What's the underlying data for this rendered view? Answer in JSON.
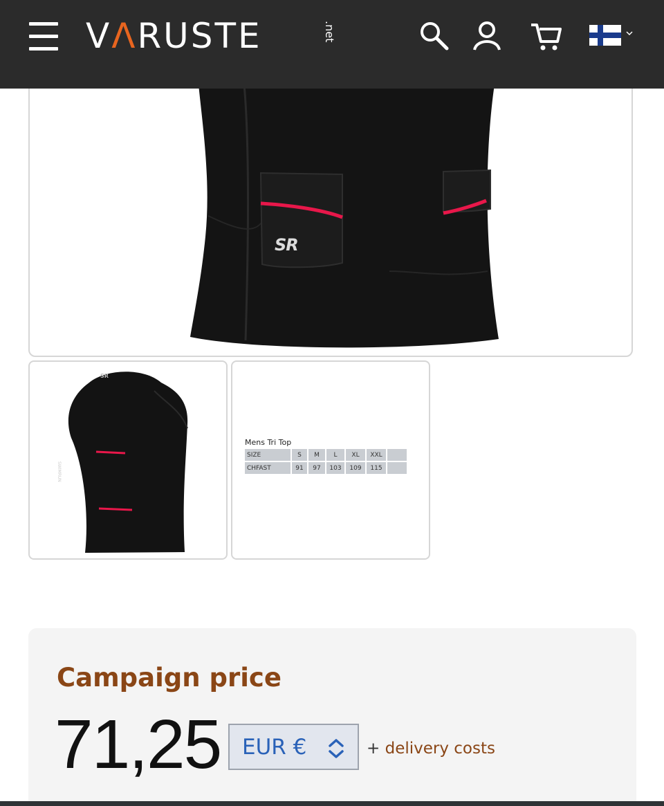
{
  "header": {
    "logo_text_1": "V",
    "logo_text_accent": "Λ",
    "logo_text_2": "RUSTE",
    "logo_suffix": ".net",
    "icons": [
      "menu-icon",
      "search-icon",
      "user-icon",
      "cart-icon",
      "finland-flag-icon"
    ]
  },
  "gallery": {
    "main_badge": "SR",
    "thumb_badge": "SR",
    "thumb_side_text": "SWIMRUN"
  },
  "size_chart": {
    "title": "Mens Tri Top",
    "header": [
      "SIZE",
      "S",
      "M",
      "L",
      "XL",
      "XXL",
      ""
    ],
    "row": [
      "CHFAST",
      "91",
      "97",
      "103",
      "109",
      "115",
      ""
    ]
  },
  "price": {
    "campaign_label": "Campaign price",
    "amount": "71,25",
    "currency": "EUR €",
    "delivery_prefix": "+",
    "delivery_link": "delivery costs"
  },
  "colors": {
    "header_bg": "#2b2b2b",
    "logo_accent": "#e8651f",
    "campaign_text": "#8a4616",
    "currency_text": "#2a62b8",
    "shirt": "#151515",
    "shirt_stripe": "#e8174a"
  }
}
